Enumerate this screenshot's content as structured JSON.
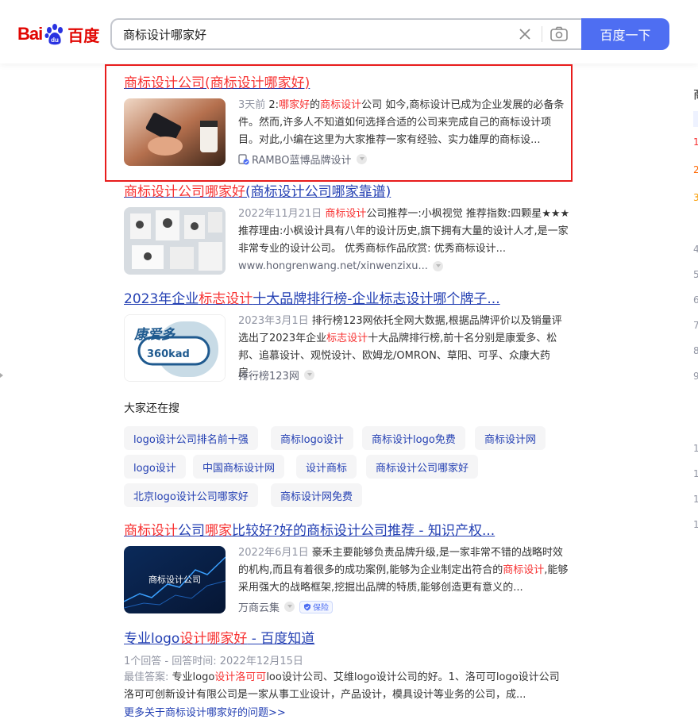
{
  "logo": {
    "bai": "Bai",
    "du": "du",
    "baidu_cn": "百度"
  },
  "search": {
    "query": "商标设计哪家好",
    "button_label": "百度一下"
  },
  "results": [
    {
      "title_parts": [
        "商标设计公司(商标设计哪家好)"
      ],
      "date": "3天前",
      "snippet": [
        {
          "t": " 2:",
          "h": false
        },
        {
          "t": "哪家好",
          "h": true
        },
        {
          "t": "的",
          "h": false
        },
        {
          "t": "商标设计",
          "h": true
        },
        {
          "t": "公司 如今,商标设计已成为企业发展的必备条件。然而,许多人不知道如何选择合适的公司来完成自己的商标设计项目。对此,小编在这里为大家推荐一家有经验、实力雄厚的商标设...",
          "h": false
        }
      ],
      "source": "RAMBO蓝博品牌设计"
    },
    {
      "title_parts": [
        "商标设计公司哪家好",
        "(商标设计公司哪家靠谱)"
      ],
      "date": "2022年11月21日",
      "snippet_h": "商标设计",
      "snippet_rest": "公司推荐一:小枫视觉 推荐指数:四颗星★★★ 推荐理由:小枫设计具有八年的设计历史,旗下拥有大量的设计人才,是一家非常专业的设计公司。 优秀商标作品欣赏: 优秀商标设计...",
      "source": "www.hongrenwang.net/xinwenzixu..."
    },
    {
      "title_parts": [
        "2023年企业",
        "标志设计",
        "十大品牌排行榜-企业标志设计哪个牌子..."
      ],
      "date": "2023年3月1日",
      "snippet_a": "排行榜123网依托全网大数据,根据品牌评价以及销量评选出了2023年企业",
      "snippet_h": "标志设计",
      "snippet_b": "十大品牌排行榜,前十名分别是康爱多、松邦、追慕设计、观悦设计、欧姆龙/OMRON、草阳、可孚、众康大药房...",
      "source": "排行榜123网",
      "thumb_text_1": "康爱多",
      "thumb_text_2": "360kad"
    },
    {
      "title_parts": [
        "商标设计",
        "公司",
        "哪家",
        "比较好?好的商标设计公司推荐 - 知识产权..."
      ],
      "date": "2022年6月1日",
      "snippet_a": "豪禾主要能够负责品牌升级,是一家非常不错的战略时效的机构,而且有着很多的成功案例,能够为企业制定出符合的",
      "snippet_h": "商标设计",
      "snippet_b": ",能够采用强大的战略框架,挖掘出品牌的特质,能够创造更有意义的...",
      "source": "万商云集",
      "badge": "保险",
      "thumb_text": "商标设计公司"
    },
    {
      "title_parts": [
        "专业logo",
        "设计哪家好",
        " - 百度知道"
      ],
      "meta": "1个回答 - 回答时间: 2022年12月15日",
      "ans_label": "最佳答案:",
      "ans_a": " 专业logo",
      "ans_h": "设计洛可可",
      "ans_b": "loo设计公司、艾维logo设计公司的好。1、洛可可logo设计公司 洛可可创新设计有限公司是一家从事工业设计，产品设计，模具设计等业务的公司，成...",
      "more": "更多关于商标设计哪家好的问题>>"
    }
  ],
  "related": {
    "title": "大家还在搜",
    "chips": [
      "logo设计公司排名前十强",
      "商标logo设计",
      "商标设计logo免费",
      "商标设计网",
      "logo设计",
      "中国商标设计网",
      "设计商标",
      "商标设计公司哪家好",
      "北京logo设计公司哪家好",
      "商标设计网免费"
    ]
  },
  "right_column": [
    "商",
    "1",
    "2",
    "3",
    "4",
    "5",
    "6",
    "7",
    "8",
    "9",
    "1",
    "1",
    "1",
    "1"
  ],
  "colors": {
    "link": "#2440b3",
    "highlight": "#f73131",
    "button": "#4e6ef2",
    "box": "#e81c1c"
  }
}
